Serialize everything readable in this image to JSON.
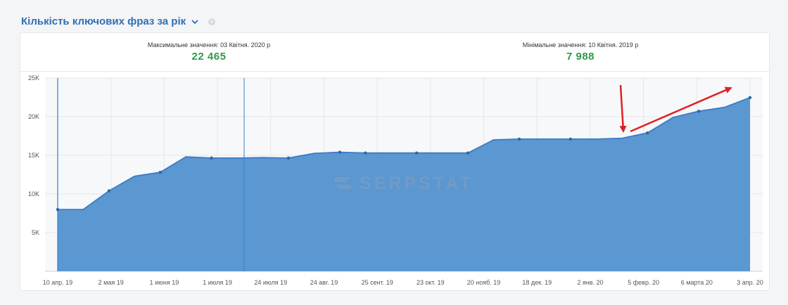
{
  "header": {
    "title": "Кількість ключових фраз за рік",
    "chevron_icon": "chevron-down-icon",
    "info_icon": "info-icon"
  },
  "stats": {
    "max_label": "Максимальне значення: 03 Квітня. 2020 р",
    "max_value": "22 465",
    "min_label": "Мінімальне значення: 10 Квітня. 2019 р",
    "min_value": "7 988"
  },
  "watermark": "SERPSTAT",
  "colors": {
    "area": "#5b97d1",
    "line": "#3b7cc4",
    "value": "#2e9a4a",
    "arrow": "#e02020"
  },
  "chart_data": {
    "type": "area",
    "ylim": [
      0,
      25000
    ],
    "y_ticks": [
      {
        "value": 5000,
        "label": "5K"
      },
      {
        "value": 10000,
        "label": "10K"
      },
      {
        "value": 15000,
        "label": "15K"
      },
      {
        "value": 20000,
        "label": "20K"
      },
      {
        "value": 25000,
        "label": "25K"
      }
    ],
    "x_labels": [
      "10 апр. 19",
      "2 мая 19",
      "1 июня 19",
      "1 июля 19",
      "24 июля 19",
      "24 авг. 19",
      "25 сент. 19",
      "23 окт. 19",
      "20 нояб. 19",
      "18 дек. 19",
      "2 янв. 20",
      "5 февр. 20",
      "6 марта 20",
      "3 апр. 20"
    ],
    "x": [
      0,
      1,
      2,
      3,
      4,
      5,
      6,
      7,
      8,
      9,
      10,
      11,
      12,
      13,
      14,
      15,
      16,
      17,
      18,
      19,
      20,
      21,
      22,
      23,
      24,
      25,
      26,
      27
    ],
    "values": [
      7988,
      8000,
      10400,
      12300,
      12800,
      14800,
      14650,
      14650,
      14700,
      14650,
      15250,
      15400,
      15300,
      15300,
      15300,
      15300,
      15300,
      17000,
      17100,
      17100,
      17100,
      17100,
      17200,
      17900,
      19900,
      20700,
      21200,
      22465
    ],
    "markers_at": [
      0,
      2,
      4,
      6,
      9,
      11,
      12,
      14,
      16,
      18,
      20,
      23,
      25,
      27
    ],
    "grid": true
  }
}
